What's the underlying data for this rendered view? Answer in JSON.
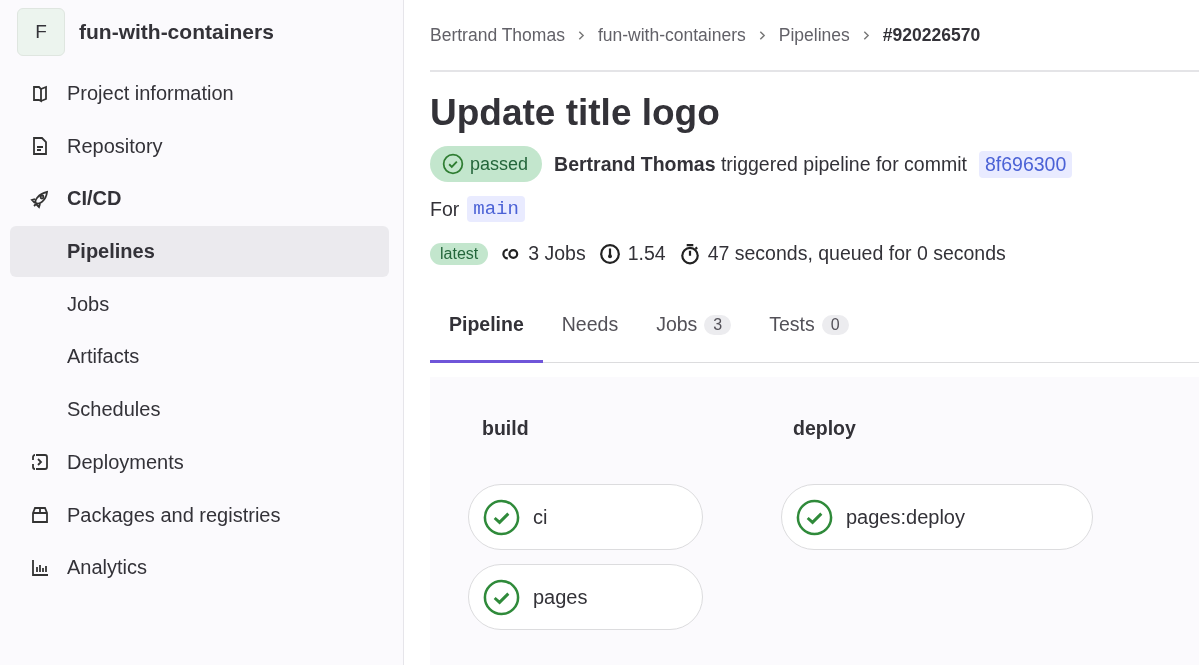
{
  "sidebar": {
    "avatar": "F",
    "project": "fun-with-containers",
    "items": [
      {
        "label": "Project information",
        "kind": "section",
        "selected": false
      },
      {
        "label": "Repository",
        "kind": "section",
        "selected": false
      },
      {
        "label": "CI/CD",
        "kind": "section",
        "selected": false
      },
      {
        "label": "Pipelines",
        "kind": "sub",
        "selected": true
      },
      {
        "label": "Jobs",
        "kind": "sub",
        "selected": false
      },
      {
        "label": "Artifacts",
        "kind": "sub",
        "selected": false
      },
      {
        "label": "Schedules",
        "kind": "sub",
        "selected": false
      },
      {
        "label": "Deployments",
        "kind": "section",
        "selected": false
      },
      {
        "label": "Packages and registries",
        "kind": "section",
        "selected": false
      },
      {
        "label": "Analytics",
        "kind": "section",
        "selected": false
      }
    ]
  },
  "breadcrumb": [
    "Bertrand Thomas",
    "fun-with-containers",
    "Pipelines",
    "#920226570"
  ],
  "title": "Update title logo",
  "status": {
    "badge": "passed",
    "text": "**Bertrand Thomas** triggered pipeline for commit",
    "commit": "8f696300"
  },
  "ref": {
    "label": "For",
    "branch": "main"
  },
  "meta": {
    "tag": "latest",
    "jobs": "3 Jobs",
    "compute": "1.54",
    "duration": "47 seconds, queued for 0 seconds"
  },
  "tabs": [
    {
      "label": "Pipeline",
      "selected": true
    },
    {
      "label": "Needs",
      "selected": false
    },
    {
      "label": "Jobs",
      "count": "3",
      "selected": false
    },
    {
      "label": "Tests",
      "count": "0",
      "selected": false
    }
  ],
  "stages": [
    {
      "name": "build",
      "jobs": [
        {
          "name": "ci",
          "passed": true
        },
        {
          "name": "pages",
          "passed": true
        }
      ]
    },
    {
      "name": "deploy",
      "jobs": [
        {
          "name": "pages:deploy",
          "passed": true
        }
      ]
    }
  ]
}
